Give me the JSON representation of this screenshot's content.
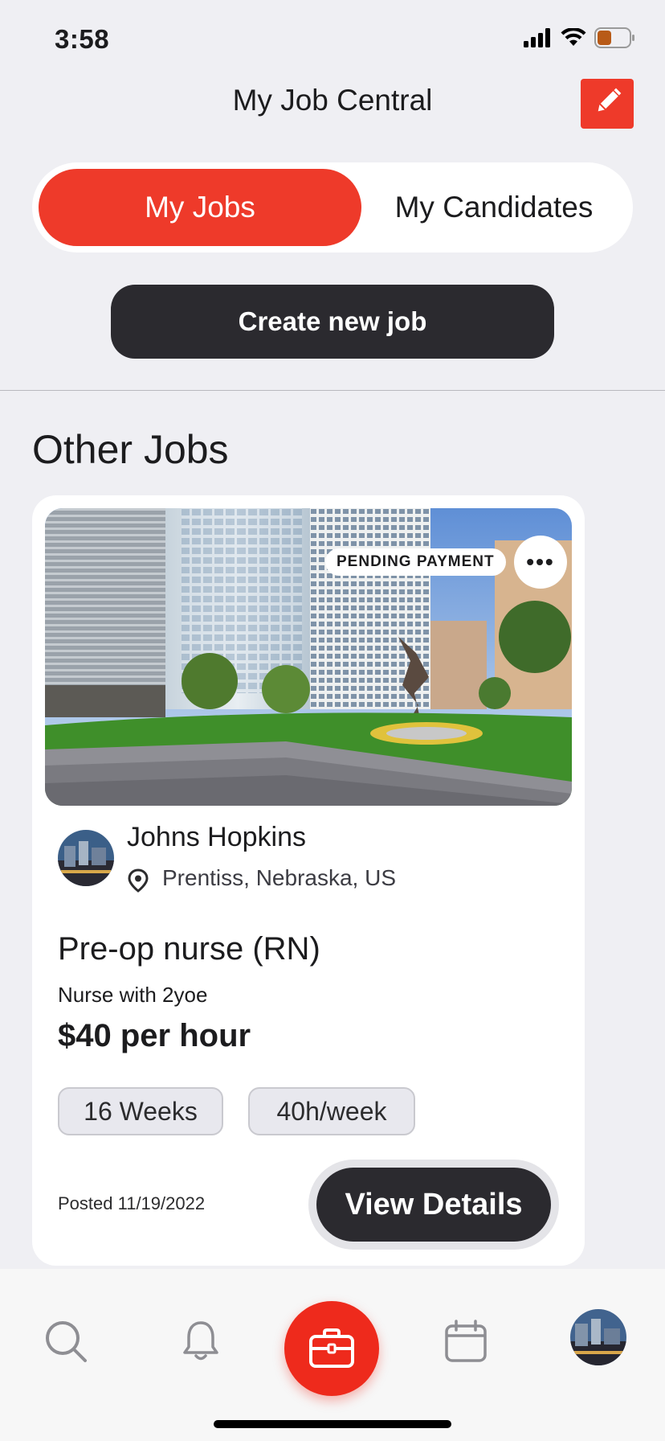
{
  "status_bar": {
    "time": "3:58"
  },
  "header": {
    "title": "My Job Central"
  },
  "segments": {
    "active_label": "My Jobs",
    "inactive_label": "My Candidates"
  },
  "actions": {
    "create_job_label": "Create new job"
  },
  "section": {
    "title": "Other Jobs"
  },
  "job_card": {
    "status_badge": "PENDING PAYMENT",
    "more_label": "•••",
    "company": "Johns Hopkins",
    "location": "Prentiss, Nebraska, US",
    "title": "Pre-op nurse (RN)",
    "description": "Nurse with 2yoe",
    "pay": "$40 per hour",
    "tags": [
      "16 Weeks",
      "40h/week"
    ],
    "posted": "Posted 11/19/2022",
    "view_details_label": "View Details"
  },
  "tabbar": {
    "items": [
      "search-icon",
      "bell-icon",
      "briefcase-icon",
      "calendar-icon",
      "profile-avatar"
    ],
    "active": "briefcase-icon"
  },
  "colors": {
    "accent": "#ee3a2a",
    "dark_button": "#2b2a2f",
    "background": "#efeff3"
  }
}
